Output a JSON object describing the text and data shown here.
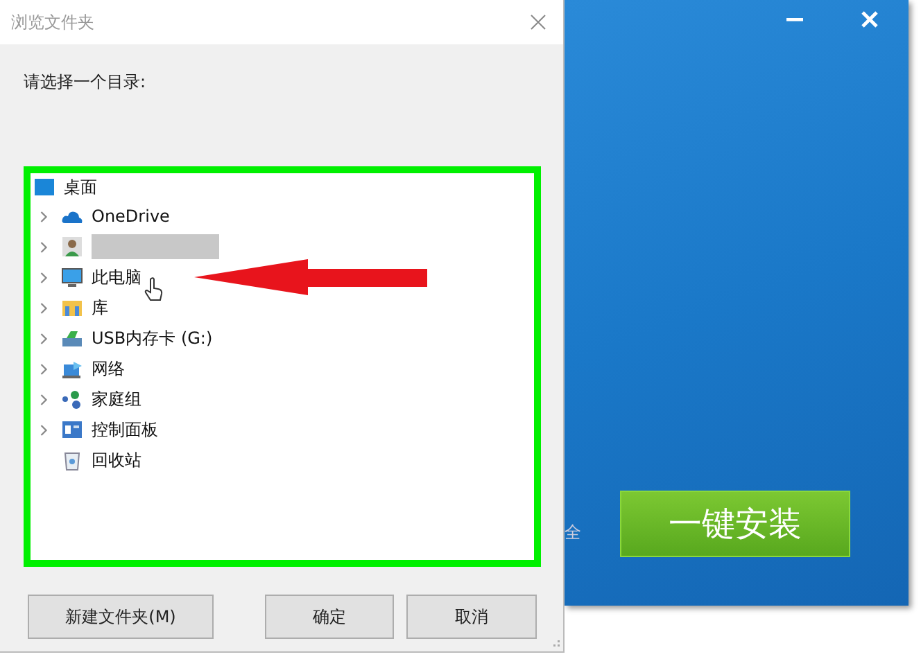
{
  "dialog": {
    "title": "浏览文件夹",
    "prompt": "请选择一个目录:",
    "tree": {
      "label": "桌面",
      "kind": "desktop",
      "children": [
        {
          "label": "OneDrive",
          "kind": "cloud",
          "expandable": true
        },
        {
          "kind": "user",
          "expandable": true,
          "redacted": true
        },
        {
          "label": "此电脑",
          "kind": "computer",
          "expandable": true
        },
        {
          "label": "库",
          "kind": "library",
          "expandable": true
        },
        {
          "label": "USB内存卡 (G:)",
          "kind": "usb",
          "expandable": true
        },
        {
          "label": "网络",
          "kind": "network",
          "expandable": true
        },
        {
          "label": "家庭组",
          "kind": "homegroup",
          "expandable": true
        },
        {
          "label": "控制面板",
          "kind": "control-panel",
          "expandable": true
        },
        {
          "label": "回收站",
          "kind": "recycle-bin",
          "expandable": false
        }
      ]
    },
    "buttons": [
      {
        "label": "新建文件夹(M)",
        "kind": "new-folder"
      },
      {
        "label": "确定",
        "kind": "ok"
      },
      {
        "label": "取消",
        "kind": "cancel"
      }
    ]
  },
  "installer": {
    "install_button": "一键安装",
    "behind_text": "全"
  }
}
